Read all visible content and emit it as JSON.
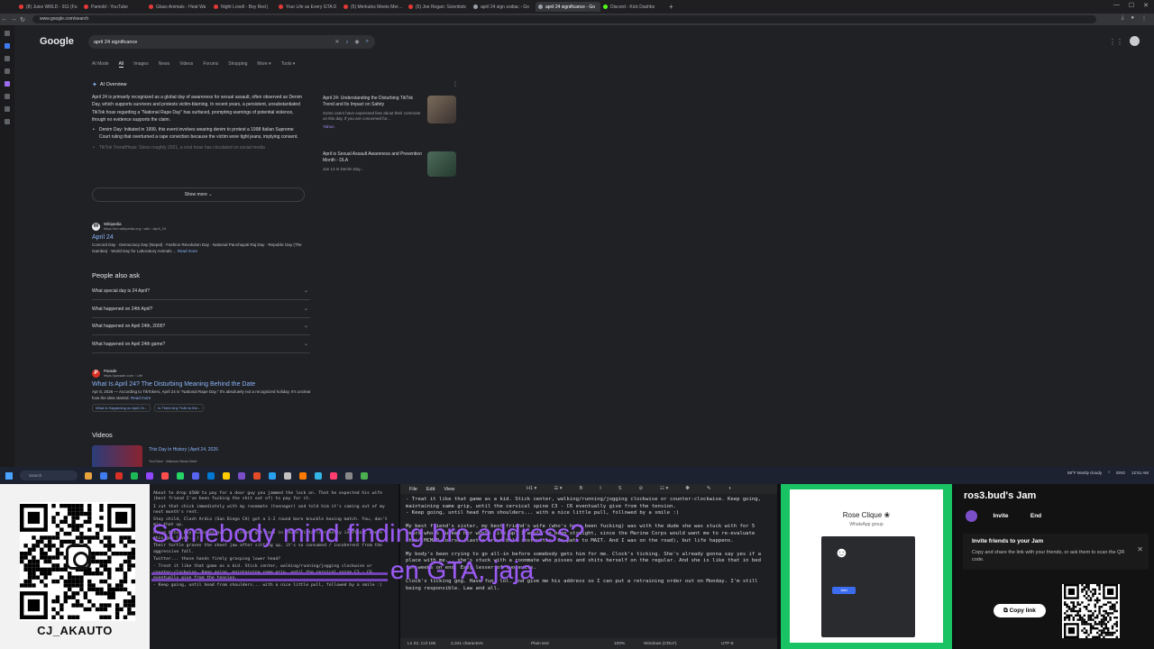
{
  "browser": {
    "tabs": [
      {
        "label": "(8) Juice WRLD - 911 (Fu",
        "color": "#e53935"
      },
      {
        "label": "Pamold - YouTube",
        "color": "#e53935"
      },
      {
        "label": "Glass Animals - Heat Wa",
        "color": "#e53935"
      },
      {
        "label": "Night Lovell - Boy Red |",
        "color": "#e53935"
      },
      {
        "label": "Your Life as Every GTA D",
        "color": "#e53935"
      },
      {
        "label": "(5) Merkules Meets Merca",
        "color": "#e53935"
      },
      {
        "label": "(5) Joe Rogan: Scientists",
        "color": "#e53935"
      },
      {
        "label": "april 24 sign zodiac - Go",
        "color": "#9aa0a6"
      },
      {
        "label": "april 24 significance - Go",
        "color": "#9aa0a6",
        "active": true
      },
      {
        "label": "Discord - Kick Dashbo",
        "color": "#53fc18"
      }
    ],
    "new_tab": "+",
    "url": "www.google.com/search"
  },
  "google": {
    "logo": "Google",
    "query": "april 24 significance",
    "tabs": [
      "AI Mode",
      "All",
      "Images",
      "News",
      "Videos",
      "Forums",
      "Shopping",
      "More ▾",
      "Tools ▾"
    ],
    "ai_overview": {
      "title": "AI Overview",
      "paragraph": "April 24 is primarily recognized as a global day of awareness for sexual assault, often observed as Denim Day, which supports survivors and protests victim-blaming. In recent years, a persistent, unsubstantiated TikTok hoax regarding a \"National Rape Day\" has surfaced, prompting warnings of potential violence, though no evidence supports the claim.",
      "bullet": "Denim Day: Initiated in 1999, this event involves wearing denim to protest a 1998 Italian Supreme Court ruling that overturned a rape conviction because the victim wore tight jeans, implying consent.",
      "fade": "TikTok Trend/Hoax: Since roughly 2021, a viral hoax has circulated on social media",
      "cards": [
        {
          "title": "April 24: Understanding the Disturbing TikTok Trend and Its Impact on Safety",
          "sub": "Some users have expressed fear about their commute on this day. If you are concerned for...",
          "src": "Yahoo"
        },
        {
          "title": "April is Sexual Assault Awareness and Prevention Month - DLA",
          "sub": "Jan 13 Is Denim Day...",
          "src": ""
        }
      ],
      "show_more": "Show more ⌄"
    },
    "wiki": {
      "name": "Wikipedia",
      "url": "https://en.wikipedia.org › wiki › April_24",
      "title": "April 24",
      "snippet": "Concord Day · Democracy Day (Nepal) · Fashion Revolution Day · National Panchayati Raj Day · Republic Day (The Gambia) · World Day for Laboratory Animals ...",
      "read_more": "Read more"
    },
    "paa": {
      "heading": "People also ask",
      "questions": [
        "What special day is 24 April?",
        "What happened on 24th April?",
        "What happened on April 24th, 2005?",
        "What happened on April 24th game?"
      ]
    },
    "parade": {
      "name": "Parade",
      "url": "https://parade.com › Life",
      "title": "What Is April 24? The Disturbing Meaning Behind the Date",
      "snippet": "Apr 8, 2026 — According to TikTokers, April 24 is \"National Rape Day.\" It's absolutely not a recognized holiday. It's unclear how the idea started.",
      "read_more": "Read more",
      "chips": [
        "What is Happening on April 24...",
        "Is There Any Truth to the..."
      ]
    },
    "videos": {
      "heading": "Videos",
      "title": "This Day In History | April 24, 2026",
      "source": "YouTube · Alliance News Brief"
    }
  },
  "taskbar": {
    "search": "Search",
    "tray": [
      "58°F Mostly cloudy",
      "^",
      "ENG",
      "12:51 AM"
    ]
  },
  "stream": {
    "qr_label": "CJ_AKAUTO",
    "left_doc": [
      "About to drop $500 to pay for a door guy you jammed the lock on. That he expected his wife (best friend I've been fucking the shit out of) to pay for it.",
      "I cut that chick immediately with my roommate (teenager) and told him it's coming out of my next month's rent.",
      "Stay child, Clash Ardia (San Diego CA) got a 1-2 round bare knuckle boxing match. You, don't mix that up.",
      "Alive bitch boy business out. I already get tons in Chula Vista (currently in Plaza, where this guy lived...)",
      "Their turtle graves the sheet jaw after sitting up, it's so consumed / incoherent from the aggressive fall.",
      "Twitter... those hands firmly grasping lower head?",
      "- Treat it like that game as a kid. Stick center, walking/running/jogging clockwise or counter-clockwise. Keep going, maintaining same grip, until the cervical spine C3 - C6 eventually give from the tension.",
      "- Keep going, until head from shoulders... with a nice little pull, followed by a smile :)"
    ],
    "left_status": "Ln 1, Col 1",
    "notepad": {
      "menu": [
        "File",
        "Edit",
        "View"
      ],
      "tools": [
        "H1 ▾",
        "☰ ▾",
        "B",
        "I",
        "S",
        "⊘",
        "☷ ▾",
        "✽",
        "✎",
        "◑"
      ],
      "text": "- Treat it like that game as a kid. Stick center, walking/running/jogging clockwise or counter-clockwise. Keep going, maintaining same grip, until the cervical spine C3 - C6 eventually give from the tension.\n- Keep going, until head from shoulders... with a nice little pull, followed by a smile :)\n\nMy best friend's sister, my best friend's wife (who's he's been fucking) was with the dude she was stuck with for 5 years who's fucked her whole life up. I would've been straight, since the Marine Corps would want me to re-evaluate their MCMAP course (last a brown belt instructor. On path to MAIT. And I was on the road), but life happens.\n\nMy body's been crying to go all-in before somebody gets him for me. Clock's ticking. She's already gonna say yes if a place with me... she's stuck with a roommate who pisses and shits herself on the regular. And she is like that in bed for weeks on end. Easy lesser of two evils.\n\nClock's ticking gng. Have fun, lol. And give me his address so I can put a retraining order out on Monday. I'm still being responsible. Law and all.",
      "status": [
        "Ln 22, Col 106",
        "2,341 characters",
        "Plain text",
        "100%",
        "Windows (CRLF)",
        "UTF-8"
      ]
    },
    "caption_line1": "Somebody mind finding bro address?",
    "caption_line2": "en GTA, jaja",
    "whatsapp": {
      "name": "Rose Clique ❀",
      "sub": "WhatsApp group",
      "emoji": "☻",
      "button": "Add"
    },
    "jam": {
      "title": "ros3.bud's Jam",
      "invite": "Invite",
      "end": "End",
      "box_title": "Invite friends to your Jam",
      "box_body": "Copy and share the link with your friends, or ask them to scan the QR code.",
      "close": "✕",
      "copy": "⧉ Copy link"
    }
  }
}
